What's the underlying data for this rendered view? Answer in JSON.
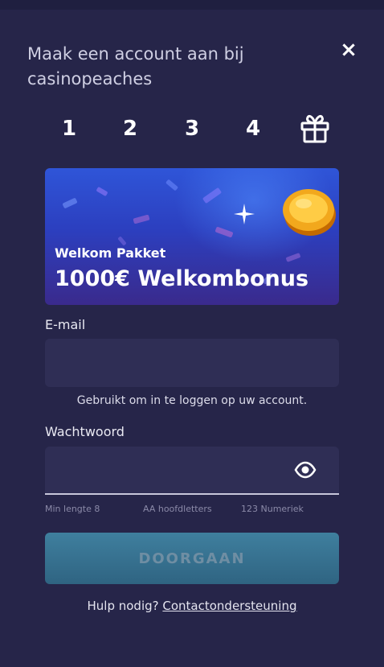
{
  "modal": {
    "title": "Maak een account aan bij casinopeaches",
    "close_label": "×"
  },
  "steps": [
    "1",
    "2",
    "3",
    "4"
  ],
  "step_final_icon": "gift-icon",
  "banner": {
    "subtitle": "Welkom Pakket",
    "headline": "1000€ Welkombonus"
  },
  "email": {
    "label": "E-mail",
    "value": "",
    "placeholder": "",
    "hint": "Gebruikt om in te loggen op uw account."
  },
  "password": {
    "label": "Wachtwoord",
    "value": "",
    "placeholder": "",
    "toggle_icon": "eye-icon",
    "rules": [
      "Min lengte 8",
      "AA hoofdletters",
      "123 Numeriek"
    ]
  },
  "submit_label": "DOORGAAN",
  "help": {
    "text": "Hulp nodig?",
    "link": "Contactondersteuning"
  },
  "colors": {
    "background": "#262549",
    "field": "#2f2e55",
    "button": "#3a7594",
    "button_text": "#6f8ea3"
  }
}
